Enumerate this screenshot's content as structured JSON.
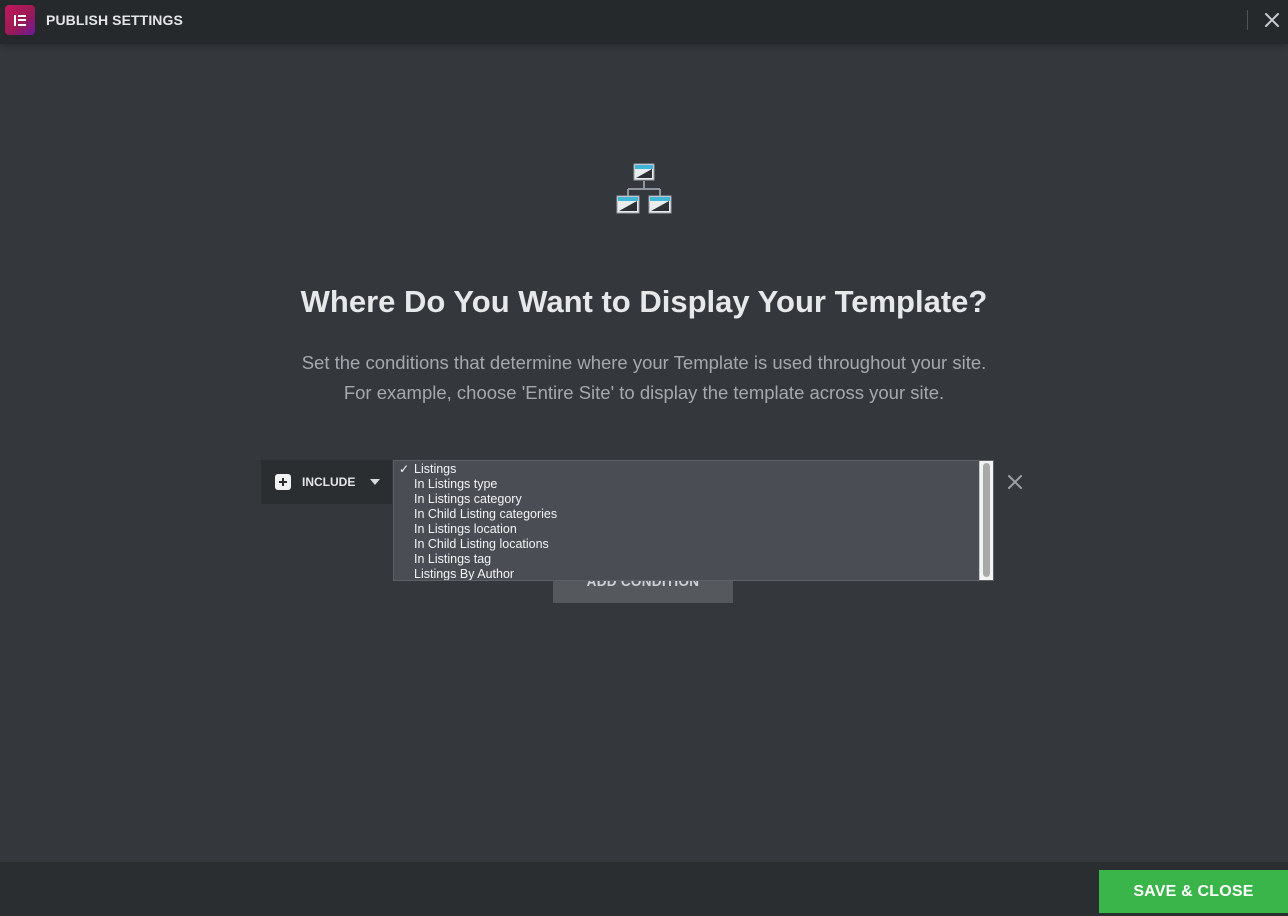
{
  "header": {
    "title": "PUBLISH SETTINGS",
    "logo_icon": "elementor-logo-icon",
    "close_icon": "close-icon"
  },
  "hero": {
    "icon": "sitemap-icon",
    "title": "Where Do You Want to Display Your Template?",
    "description_line1": "Set the conditions that determine where your Template is used throughout your site.",
    "description_line2": "For example, choose 'Entire Site' to display the template across your site."
  },
  "condition": {
    "include_label": "INCLUDE",
    "selected_option": "Listings",
    "options": [
      "Listings",
      "In Listings type",
      "In Listings category",
      "In Child Listing categories",
      "In Listings location",
      "In Child Listing locations",
      "In Listings tag",
      "Listings By Author"
    ],
    "check_mark": "✓"
  },
  "add_condition_label": "ADD CONDITION",
  "footer": {
    "save_label": "SAVE & CLOSE"
  },
  "colors": {
    "background": "#34383c",
    "header": "#26292c",
    "accent_green": "#39b54a",
    "logo": "#c2185b"
  }
}
